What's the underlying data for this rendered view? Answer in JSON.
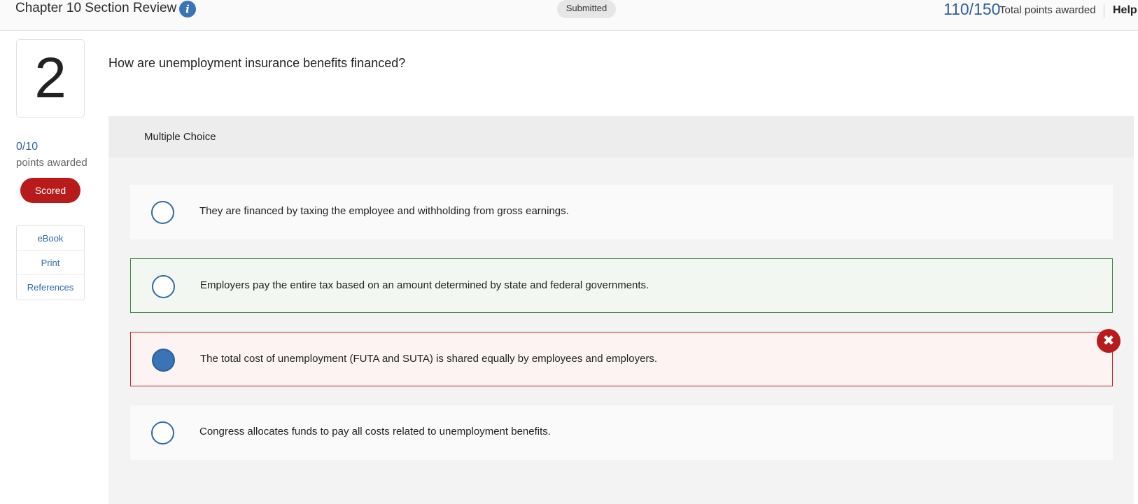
{
  "header": {
    "title": "Chapter 10 Section Review",
    "info_icon": "info-icon",
    "status": "Submitted",
    "total_score": "110/150",
    "total_label": "Total points awarded",
    "help": "Help"
  },
  "sidebar": {
    "question_number": "2",
    "points": "0/10",
    "points_label": "points awarded",
    "scored_badge": "Scored",
    "resources": [
      {
        "label": "eBook"
      },
      {
        "label": "Print"
      },
      {
        "label": "References"
      }
    ]
  },
  "question": {
    "text": "How are unemployment insurance benefits financed?",
    "type_label": "Multiple Choice",
    "options": [
      {
        "label": "They are financed by taxing the employee and withholding from gross earnings.",
        "selected": false,
        "state": "neutral"
      },
      {
        "label": "Employers pay the entire tax based on an amount determined by state and federal governments.",
        "selected": false,
        "state": "correct"
      },
      {
        "label": "The total cost of unemployment (FUTA and SUTA) is shared equally by employees and employers.",
        "selected": true,
        "state": "incorrect"
      },
      {
        "label": "Congress allocates funds to pay all costs related to unemployment benefits.",
        "selected": false,
        "state": "neutral"
      }
    ],
    "incorrect_icon": "close-circle-icon"
  },
  "colors": {
    "accent": "#2f5f9e",
    "correct": "#3c8a3c",
    "incorrect": "#b81b1b"
  }
}
